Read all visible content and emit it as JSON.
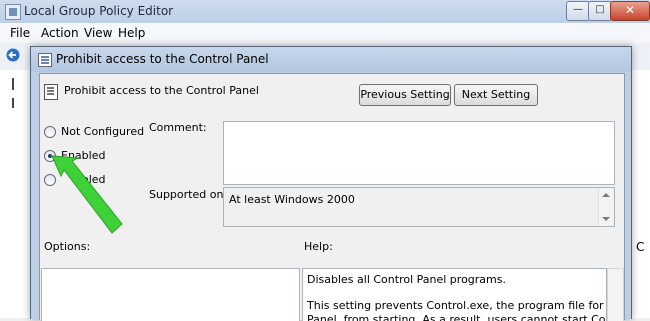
{
  "background_window": {
    "title": "Local Group Policy Editor",
    "menu": [
      "File",
      "Action",
      "View",
      "Help"
    ],
    "right_fragment": "C",
    "controls": {
      "minimize": "—",
      "maximize": "□",
      "close": "✕"
    }
  },
  "dialog": {
    "title": "Prohibit access to the Control Panel",
    "policy_name": "Prohibit access to the Control Panel",
    "buttons": {
      "previous": "Previous Setting",
      "next": "Next Setting"
    },
    "radios": [
      {
        "label": "Not Configured",
        "checked": false
      },
      {
        "label": "Enabled",
        "checked": true
      },
      {
        "label": "Disabled",
        "checked": false,
        "visible_text": "abled"
      }
    ],
    "comment_label": "Comment:",
    "comment_value": "",
    "supported_label": "Supported on:",
    "supported_value": "At least Windows 2000",
    "options_label": "Options:",
    "help_label": "Help:",
    "help_lines": [
      "Disables all Control Panel programs.",
      "This setting prevents Control.exe, the program file for Control",
      "Panel, from starting. As a result, users cannot start Control Panel"
    ]
  },
  "colors": {
    "annotation_arrow": "#3fd13a",
    "title_bar": "#bccfe7",
    "close_button": "#c7442c"
  },
  "icons": [
    "app-icon",
    "back-arrow-icon",
    "policy-icon",
    "scroll-up-icon",
    "scroll-down-icon"
  ]
}
